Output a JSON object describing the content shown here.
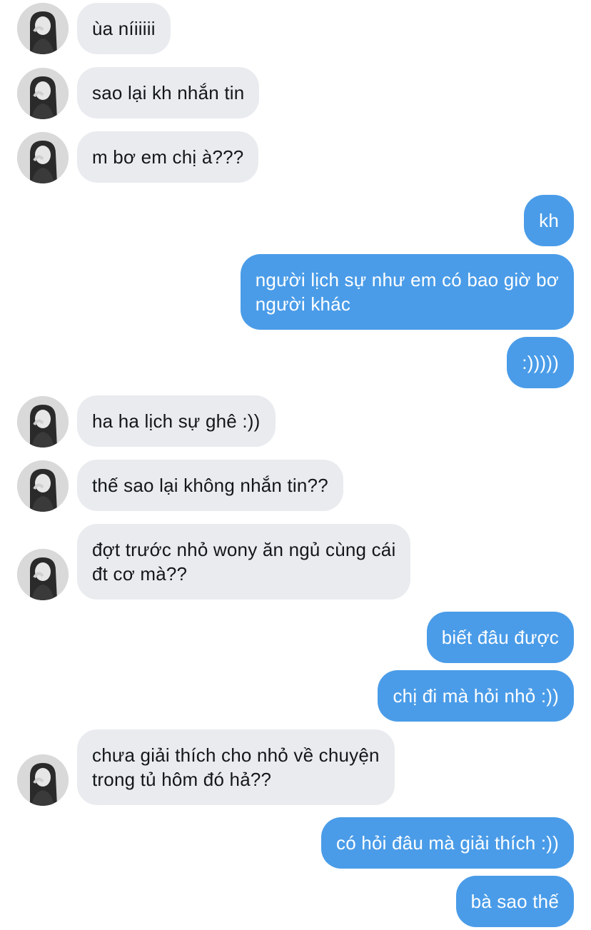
{
  "conversation": {
    "messages": [
      {
        "side": "in",
        "text": "ùa níiiiii"
      },
      {
        "side": "in",
        "text": "sao lại kh nhắn tin"
      },
      {
        "side": "in",
        "text": "m bơ em chị à???"
      },
      {
        "side": "out",
        "text": "kh"
      },
      {
        "side": "out",
        "text": "người lịch sự như em có bao giờ bơ\nngười khác"
      },
      {
        "side": "out",
        "text": ":)))))"
      },
      {
        "side": "in",
        "text": "ha ha lịch sự ghê :))"
      },
      {
        "side": "in",
        "text": "thế sao lại không nhắn tin??"
      },
      {
        "side": "in",
        "text": "đợt trước nhỏ wony ăn ngủ cùng cái\nđt cơ mà??"
      },
      {
        "side": "out",
        "text": "biết đâu được"
      },
      {
        "side": "out",
        "text": "chị đi mà hỏi nhỏ :))"
      },
      {
        "side": "in",
        "text": "chưa giải thích cho nhỏ về chuyện\ntrong tủ hôm đó hả??"
      },
      {
        "side": "out",
        "text": "có hỏi đâu mà giải thích :))"
      },
      {
        "side": "out",
        "text": "bà sao thế"
      }
    ]
  },
  "colors": {
    "incoming_bubble": "#e9ebef",
    "outgoing_bubble": "#4a9ce8"
  },
  "icons": {
    "avatar": "contact-avatar-photo"
  }
}
